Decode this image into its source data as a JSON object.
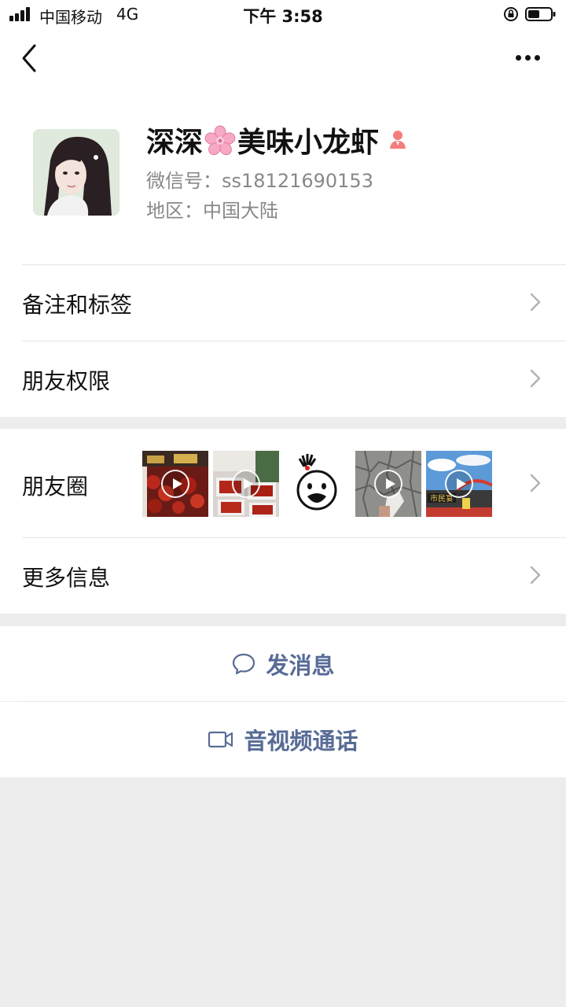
{
  "status_bar": {
    "carrier": "中国移动",
    "network": "4G",
    "time": "下午 3:58"
  },
  "profile": {
    "name_part1": "深深",
    "name_part2": "美味小龙虾",
    "wechat_id": "微信号：ss18121690153",
    "region": "地区：中国大陆"
  },
  "rows": {
    "remarks": "备注和标签",
    "permissions": "朋友权限",
    "moments": "朋友圈",
    "more_info": "更多信息"
  },
  "actions": {
    "message": "发消息",
    "call": "音视频通话"
  },
  "colors": {
    "link": "#576b95",
    "background": "#ededed",
    "gender_female": "#f37e7d"
  }
}
